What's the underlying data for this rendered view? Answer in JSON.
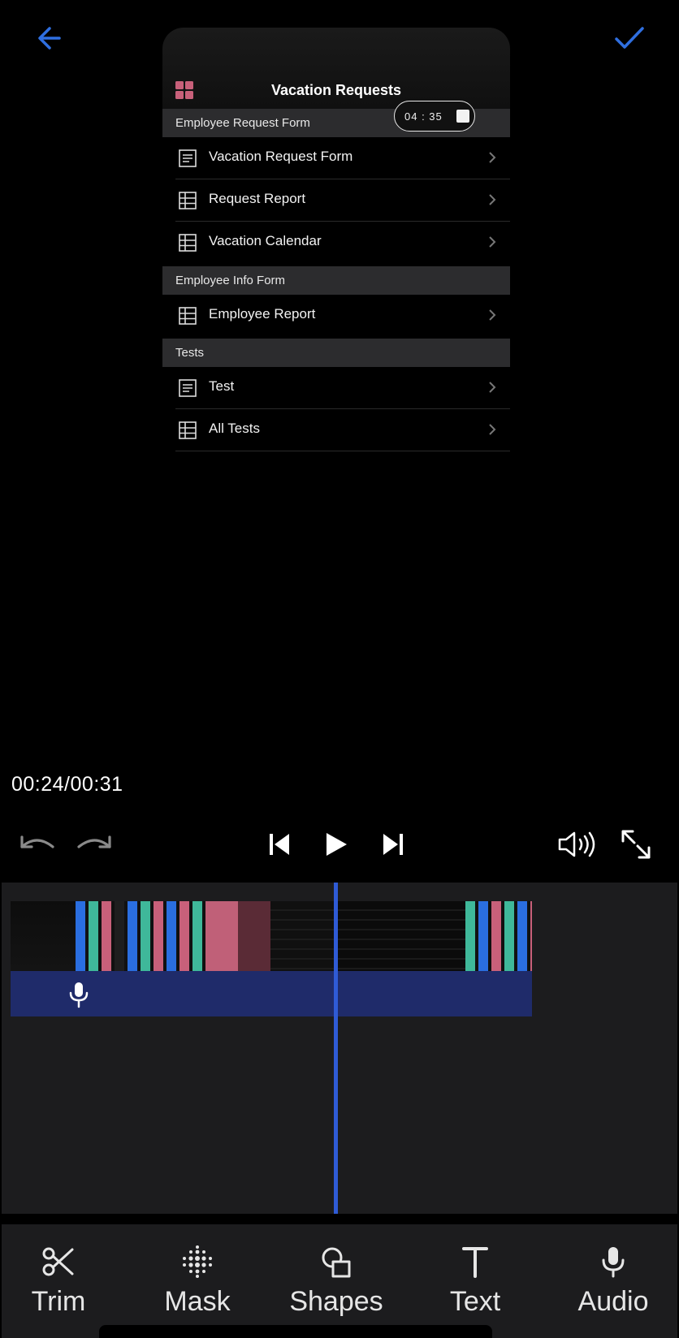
{
  "header": {
    "back_icon": "arrow-left-icon",
    "done_icon": "checkmark-icon",
    "accent": "#2f6fe0"
  },
  "preview": {
    "title": "Vacation Requests",
    "recording_time": "04 : 35",
    "sections": [
      {
        "title": "Employee Request Form",
        "rows": [
          {
            "label": "Vacation Request Form",
            "icon": "form-icon"
          },
          {
            "label": "Request Report",
            "icon": "table-icon"
          },
          {
            "label": "Vacation Calendar",
            "icon": "table-icon"
          }
        ]
      },
      {
        "title": "Employee Info Form",
        "rows": [
          {
            "label": "Employee Report",
            "icon": "table-icon"
          }
        ]
      },
      {
        "title": "Tests",
        "rows": [
          {
            "label": "Test",
            "icon": "form-icon"
          },
          {
            "label": "All Tests",
            "icon": "table-icon"
          }
        ]
      }
    ]
  },
  "playback": {
    "time": "00:24/00:31"
  },
  "tools": [
    {
      "label": "Trim",
      "icon": "scissors-icon"
    },
    {
      "label": "Mask",
      "icon": "mask-icon"
    },
    {
      "label": "Shapes",
      "icon": "shapes-icon"
    },
    {
      "label": "Text",
      "icon": "text-icon"
    },
    {
      "label": "Audio",
      "icon": "microphone-icon"
    }
  ]
}
